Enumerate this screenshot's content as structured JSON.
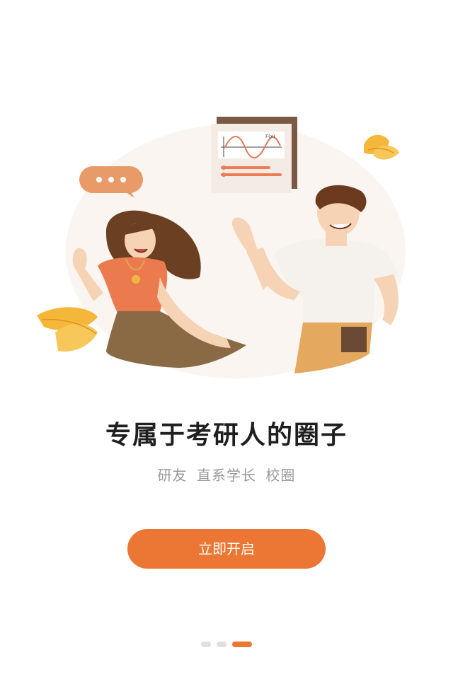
{
  "onboarding": {
    "headline": "专属于考研人的圈子",
    "subline": "研友 直系学长 校圈",
    "start_button_label": "立即开启",
    "page_indicator": {
      "total": 3,
      "current": 3
    }
  },
  "colors": {
    "accent": "#ec7633",
    "leaf": "#f5b73a",
    "circle_bg": "#faf5f0"
  },
  "illustration": {
    "icons": [
      "speech-bubble-icon",
      "chart-card-icon",
      "leaf-icon"
    ],
    "chart_card_label": "F(x)"
  }
}
